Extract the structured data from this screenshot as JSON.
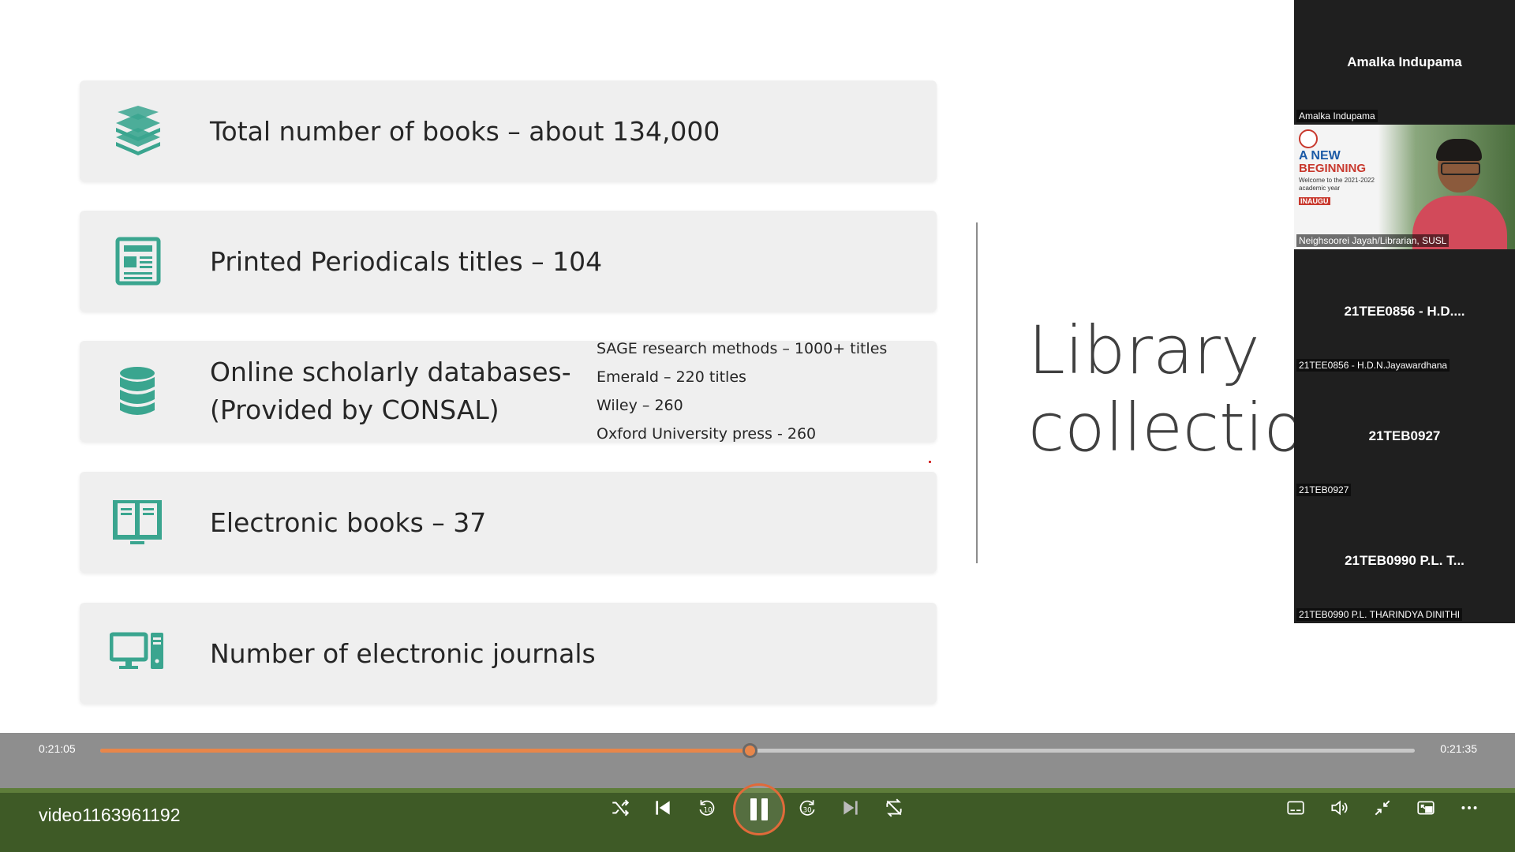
{
  "slide": {
    "cards": [
      {
        "icon": "books-stack-icon",
        "label": "Total number of books – about 134,000"
      },
      {
        "icon": "newspaper-icon",
        "label": "Printed Periodicals titles – 104"
      },
      {
        "icon": "database-icon",
        "label": "Online scholarly databases- (Provided by CONSAL)",
        "details": [
          "SAGE research methods – 1000+ titles",
          "Emerald – 220 titles",
          "Wiley – 260",
          "Oxford University press - 260"
        ]
      },
      {
        "icon": "open-book-icon",
        "label": "Electronic books – 37"
      },
      {
        "icon": "computer-icon",
        "label": "Number of electronic journals"
      }
    ],
    "title_line1": "Library",
    "title_line2": "collection"
  },
  "participants": [
    {
      "center": "Amalka Indupama",
      "small": "Amalka Indupama"
    },
    {
      "center": "",
      "small": "Neighsoorei Jayah/Librarian, SUSL",
      "poster": {
        "title1": "A NEW",
        "title2": "BEGINNING",
        "sub": "Welcome to the 2021-2022 academic year",
        "badge": "INAUGU"
      }
    },
    {
      "center": "21TEE0856 - H.D....",
      "small": "21TEE0856 - H.D.N.Jayawardhana"
    },
    {
      "center": "21TEB0927",
      "small": "21TEB0927"
    },
    {
      "center": "21TEB0990 P.L. T...",
      "small": "21TEB0990 P.L. THARINDYA DINITHI"
    }
  ],
  "player": {
    "elapsed": "0:21:05",
    "total": "0:21:35",
    "progress": 0.494,
    "title": "video1163961192",
    "accent": "#e8864a"
  }
}
